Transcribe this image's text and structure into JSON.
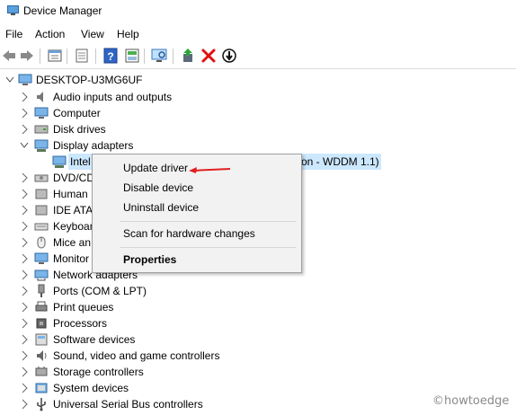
{
  "window": {
    "title": "Device Manager"
  },
  "menu": [
    "File",
    "Action",
    "View",
    "Help"
  ],
  "toolbar": {
    "icons": [
      "back-arrow-icon",
      "forward-arrow-icon",
      "properties-icon",
      "show-hidden-icon",
      "help-icon",
      "action-icon",
      "scan-hardware-icon",
      "update-driver-icon",
      "uninstall-icon",
      "disable-icon"
    ]
  },
  "tree": {
    "root": "DESKTOP-U3MG6UF",
    "categories": [
      "Audio inputs and outputs",
      "Computer",
      "Disk drives",
      "Display adapters",
      "DVD/CD",
      "Human",
      "IDE ATA/",
      "Keyboar",
      "Mice an",
      "Monitor",
      "Network adapters",
      "Ports (COM & LPT)",
      "Print queues",
      "Processors",
      "Software devices",
      "Sound, video and game controllers",
      "Storage controllers",
      "System devices",
      "Universal Serial Bus controllers"
    ],
    "selected_device_prefix": "Intel",
    "selected_device_suffix": "on - WDDM 1.1)"
  },
  "context_menu": {
    "items": [
      "Update driver",
      "Disable device",
      "Uninstall device",
      "Scan for hardware changes",
      "Properties"
    ]
  },
  "watermark": "©howtoedge",
  "colors": {
    "selection": "#cce8ff",
    "annotation_arrow": "#e02020",
    "delete": "#e01010"
  }
}
